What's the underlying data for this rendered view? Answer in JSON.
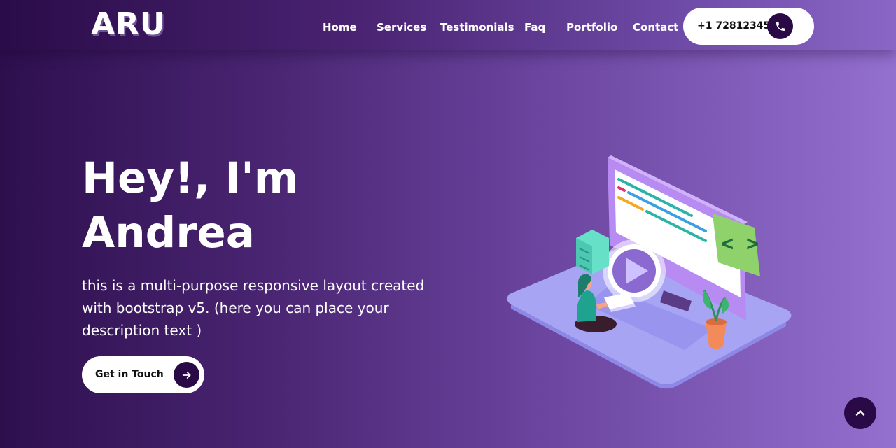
{
  "brand": {
    "logo_text": "ARU"
  },
  "nav": {
    "items": [
      {
        "label": "Home"
      },
      {
        "label": "Services"
      },
      {
        "label": "Testimonials"
      },
      {
        "label": "Faq"
      },
      {
        "label": "Portfolio"
      },
      {
        "label": "Contact"
      }
    ],
    "phone": {
      "number": "+1 728123456",
      "icon": "phone-icon"
    }
  },
  "hero": {
    "title_line1": "Hey!, I'm",
    "title_line2": "Andrea",
    "description": "this is a multi-purpose responsive layout created with bootstrap v5. (here you can place your description text )",
    "cta_label": "Get in Touch",
    "cta_icon": "arrow-right-icon"
  },
  "scroll_top": {
    "icon": "chevron-up-icon"
  },
  "colors": {
    "primary_dark": "#2a0a46",
    "gradient_start": "#2d0f4e",
    "gradient_end": "#9470cf",
    "accent_green": "#8fd16a",
    "accent_teal": "#2bb3a8",
    "platform": "#a9a6f5"
  }
}
